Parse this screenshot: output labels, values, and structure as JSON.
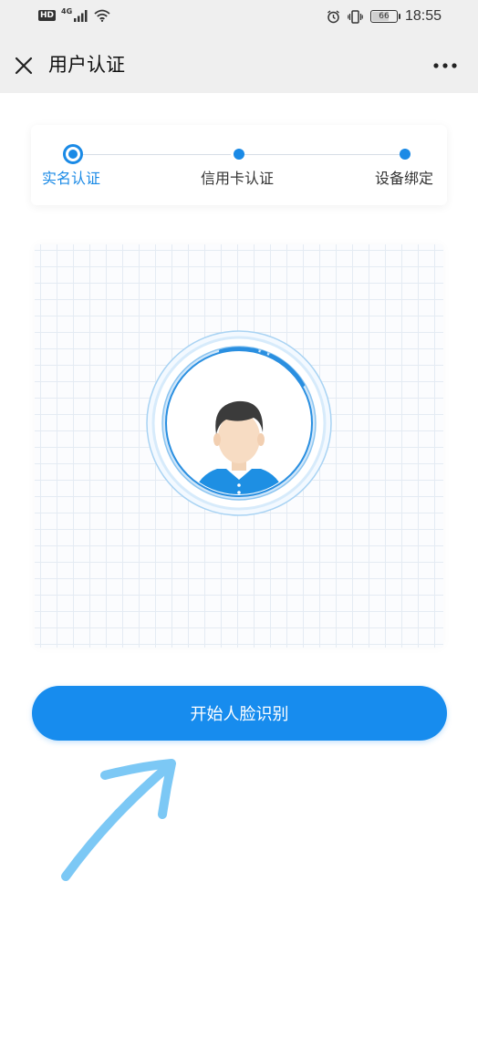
{
  "status_bar": {
    "hd": "HD",
    "network": "4G",
    "battery": "66",
    "time": "18:55"
  },
  "nav": {
    "title": "用户认证"
  },
  "steps": [
    {
      "label": "实名认证",
      "active": true
    },
    {
      "label": "信用卡认证",
      "active": false
    },
    {
      "label": "设备绑定",
      "active": false
    }
  ],
  "main": {
    "start_button": "开始人脸识别"
  },
  "colors": {
    "accent": "#178cee",
    "status_bg": "#efefef",
    "annotation_arrow": "#7cc8f5"
  },
  "icons": [
    "close-icon",
    "more-icon",
    "wifi-icon",
    "signal-icon",
    "alarm-icon",
    "vibrate-icon",
    "face-avatar-icon",
    "annotation-arrow"
  ]
}
